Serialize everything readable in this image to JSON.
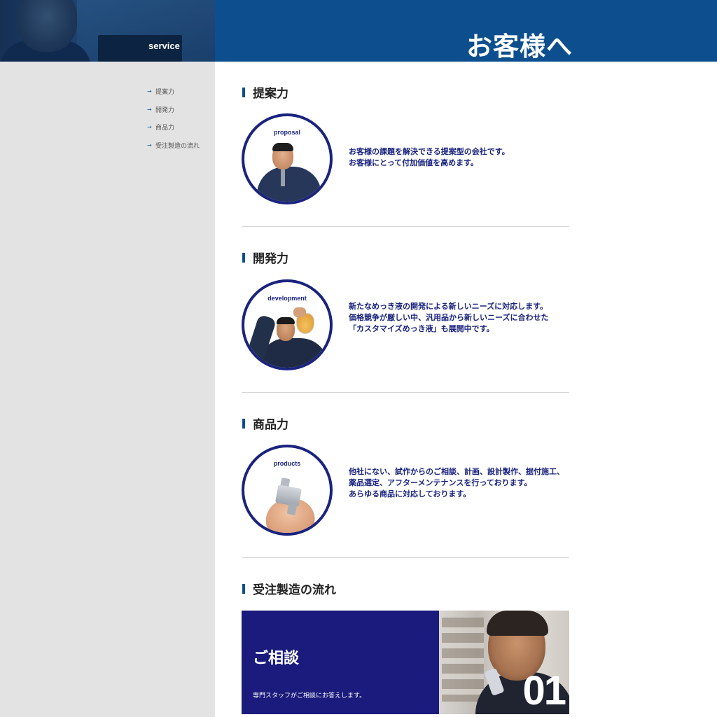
{
  "header": {
    "service_label": "service",
    "page_title": "お客様へ"
  },
  "sidebar": {
    "items": [
      {
        "label": "提案力"
      },
      {
        "label": "開発力"
      },
      {
        "label": "商品力"
      },
      {
        "label": "受注製造の流れ"
      }
    ]
  },
  "sections": [
    {
      "title": "提案力",
      "caption": "proposal",
      "lines": [
        "お客様の課題を解決できる提案型の会社です。",
        "お客様にとって付加価値を高めます。"
      ]
    },
    {
      "title": "開発力",
      "caption": "development",
      "lines": [
        "新たなめっき液の開発による新しいニーズに対応します。",
        "価格競争が厳しい中、汎用品から新しいニーズに合わせた",
        "「カスタマイズめっき液」も展開中です。"
      ]
    },
    {
      "title": "商品力",
      "caption": "products",
      "lines": [
        "他社にない、試作からのご相談、計画、設計製作、据付施工、",
        "薬品選定、アフターメンテナンスを行っております。",
        "あらゆる商品に対応しております。"
      ]
    },
    {
      "title": "受注製造の流れ"
    }
  ],
  "flow": {
    "step_title": "ご相談",
    "step_desc": "専門スタッフがご相談にお答えします。",
    "step_number": "01"
  },
  "colors": {
    "header_blue": "#0d4f8e",
    "navy": "#1a237e",
    "sidebar_bg": "#e4e3e4",
    "card_bg": "#1a1b7c"
  }
}
